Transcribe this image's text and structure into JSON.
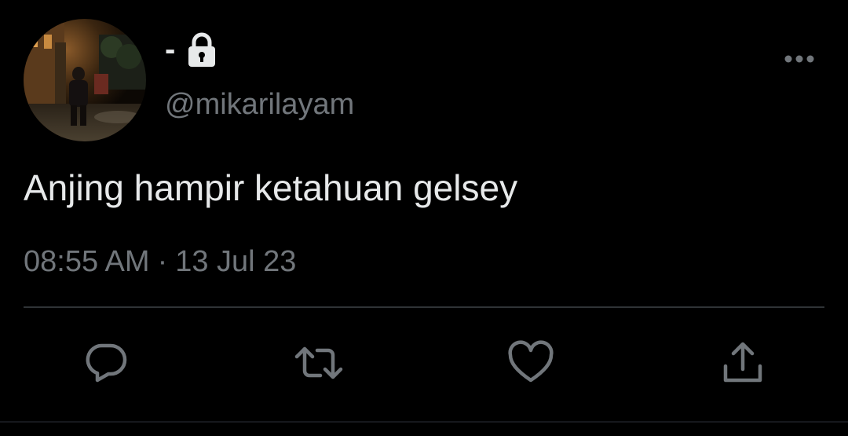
{
  "colors": {
    "background": "#000000",
    "primary_text": "#e7e9ea",
    "secondary_text": "#71767b",
    "divider": "#2f3336"
  },
  "author": {
    "display_name": "-",
    "protected_icon": "lock-icon",
    "handle": "@mikarilayam"
  },
  "tweet": {
    "text": "Anjing hampir ketahuan gelsey",
    "time": "08:55 AM",
    "separator": "·",
    "date": "13 Jul 23"
  },
  "actions": [
    {
      "icon": "reply-icon"
    },
    {
      "icon": "retweet-icon"
    },
    {
      "icon": "like-icon"
    },
    {
      "icon": "share-icon"
    }
  ],
  "more_icon": "more-options-icon"
}
